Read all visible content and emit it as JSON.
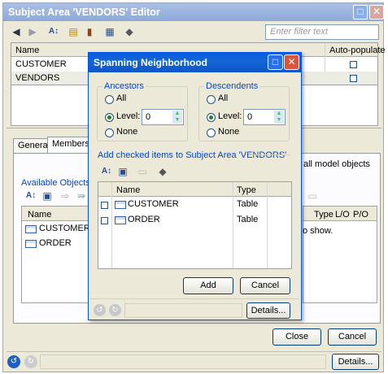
{
  "editor": {
    "title": "Subject Area 'VENDORS' Editor",
    "filter_placeholder": "Enter filter text",
    "grid": {
      "col_name": "Name",
      "col_auto": "Auto-populate",
      "rows": [
        {
          "name": "CUSTOMER"
        },
        {
          "name": "VENDORS"
        }
      ]
    },
    "tabs": {
      "general": "General",
      "members": "Members"
    },
    "available_label": "Available Objects",
    "avail_col_name": "Name",
    "available_rows": [
      {
        "name": "CUSTOMER"
      },
      {
        "name": "ORDER"
      }
    ],
    "all_model_objects": "all model objects",
    "right_cols": {
      "type": "Type",
      "lo": "L/O",
      "po": "P/O"
    },
    "to_show": "o show.",
    "close_label": "Close",
    "cancel_label": "Cancel",
    "details_label": "Details..."
  },
  "dialog": {
    "title": "Spanning Neighborhood",
    "ancestors": {
      "legend": "Ancestors",
      "all": "All",
      "level": "Level:",
      "level_value": "0",
      "none": "None"
    },
    "descendents": {
      "legend": "Descendents",
      "all": "All",
      "level": "Level:",
      "level_value": "0",
      "none": "None"
    },
    "add_checked_label": "Add checked items to Subject Area 'VENDORS'",
    "col_name": "Name",
    "col_type": "Type",
    "rows": [
      {
        "name": "CUSTOMER",
        "type": "Table"
      },
      {
        "name": "ORDER",
        "type": "Table"
      }
    ],
    "add_label": "Add",
    "cancel_label": "Cancel",
    "details_label": "Details..."
  }
}
